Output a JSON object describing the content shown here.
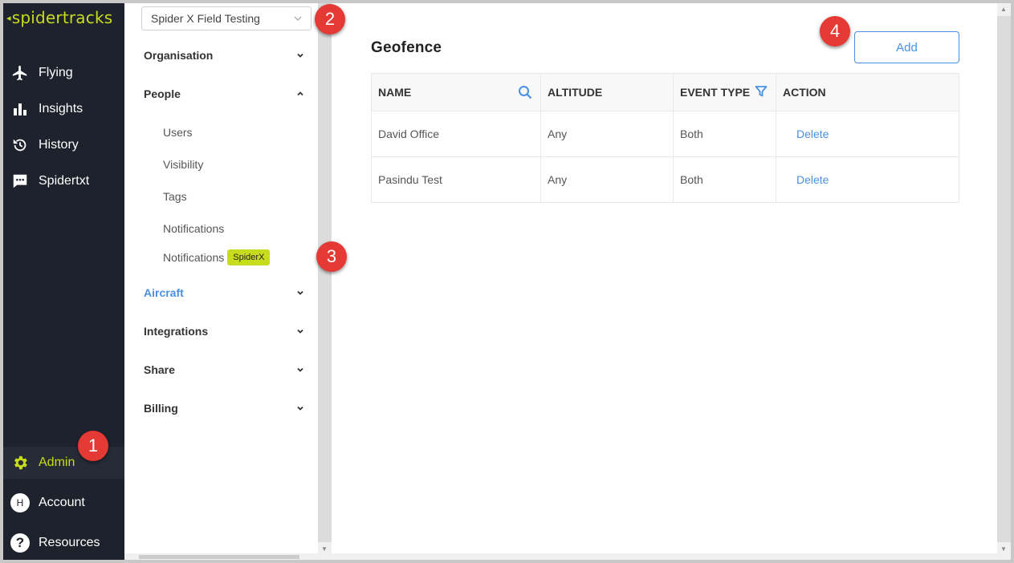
{
  "brand": {
    "logo_text": "spidertracks",
    "accent": "#c8dc1e",
    "nav_bg": "#1e222c"
  },
  "nav": {
    "items": [
      {
        "label": "Flying",
        "icon": "plane-icon"
      },
      {
        "label": "Insights",
        "icon": "bar-chart-icon"
      },
      {
        "label": "History",
        "icon": "history-icon"
      },
      {
        "label": "Spidertxt",
        "icon": "chat-icon"
      }
    ],
    "bottom": [
      {
        "label": "Admin",
        "icon": "gear-icon",
        "active": true
      },
      {
        "label": "Account",
        "icon": "avatar-icon",
        "avatar_initial": "H"
      },
      {
        "label": "Resources",
        "icon": "help-icon",
        "glyph": "?"
      }
    ]
  },
  "org_select": {
    "value": "Spider X Field Testing"
  },
  "sidebar": {
    "sections": [
      {
        "label": "Organisation",
        "expanded": false
      },
      {
        "label": "People",
        "expanded": true
      },
      {
        "label": "Aircraft",
        "expanded": false,
        "active": true
      },
      {
        "label": "Integrations",
        "expanded": false
      },
      {
        "label": "Share",
        "expanded": false
      },
      {
        "label": "Billing",
        "expanded": false
      }
    ],
    "people_items": [
      {
        "label": "Users"
      },
      {
        "label": "Visibility"
      },
      {
        "label": "Tags"
      },
      {
        "label": "Notifications"
      },
      {
        "label": "Notifications",
        "tag": "SpiderX"
      }
    ]
  },
  "main": {
    "title": "Geofence",
    "add_label": "Add",
    "columns": [
      "NAME",
      "ALTITUDE",
      "EVENT TYPE",
      "ACTION"
    ],
    "rows": [
      {
        "name": "David Office",
        "altitude": "Any",
        "event_type": "Both",
        "action": "Delete"
      },
      {
        "name": "Pasindu Test",
        "altitude": "Any",
        "event_type": "Both",
        "action": "Delete"
      }
    ],
    "link_color": "#4a90e2"
  },
  "annotations": [
    "1",
    "2",
    "3",
    "4"
  ]
}
